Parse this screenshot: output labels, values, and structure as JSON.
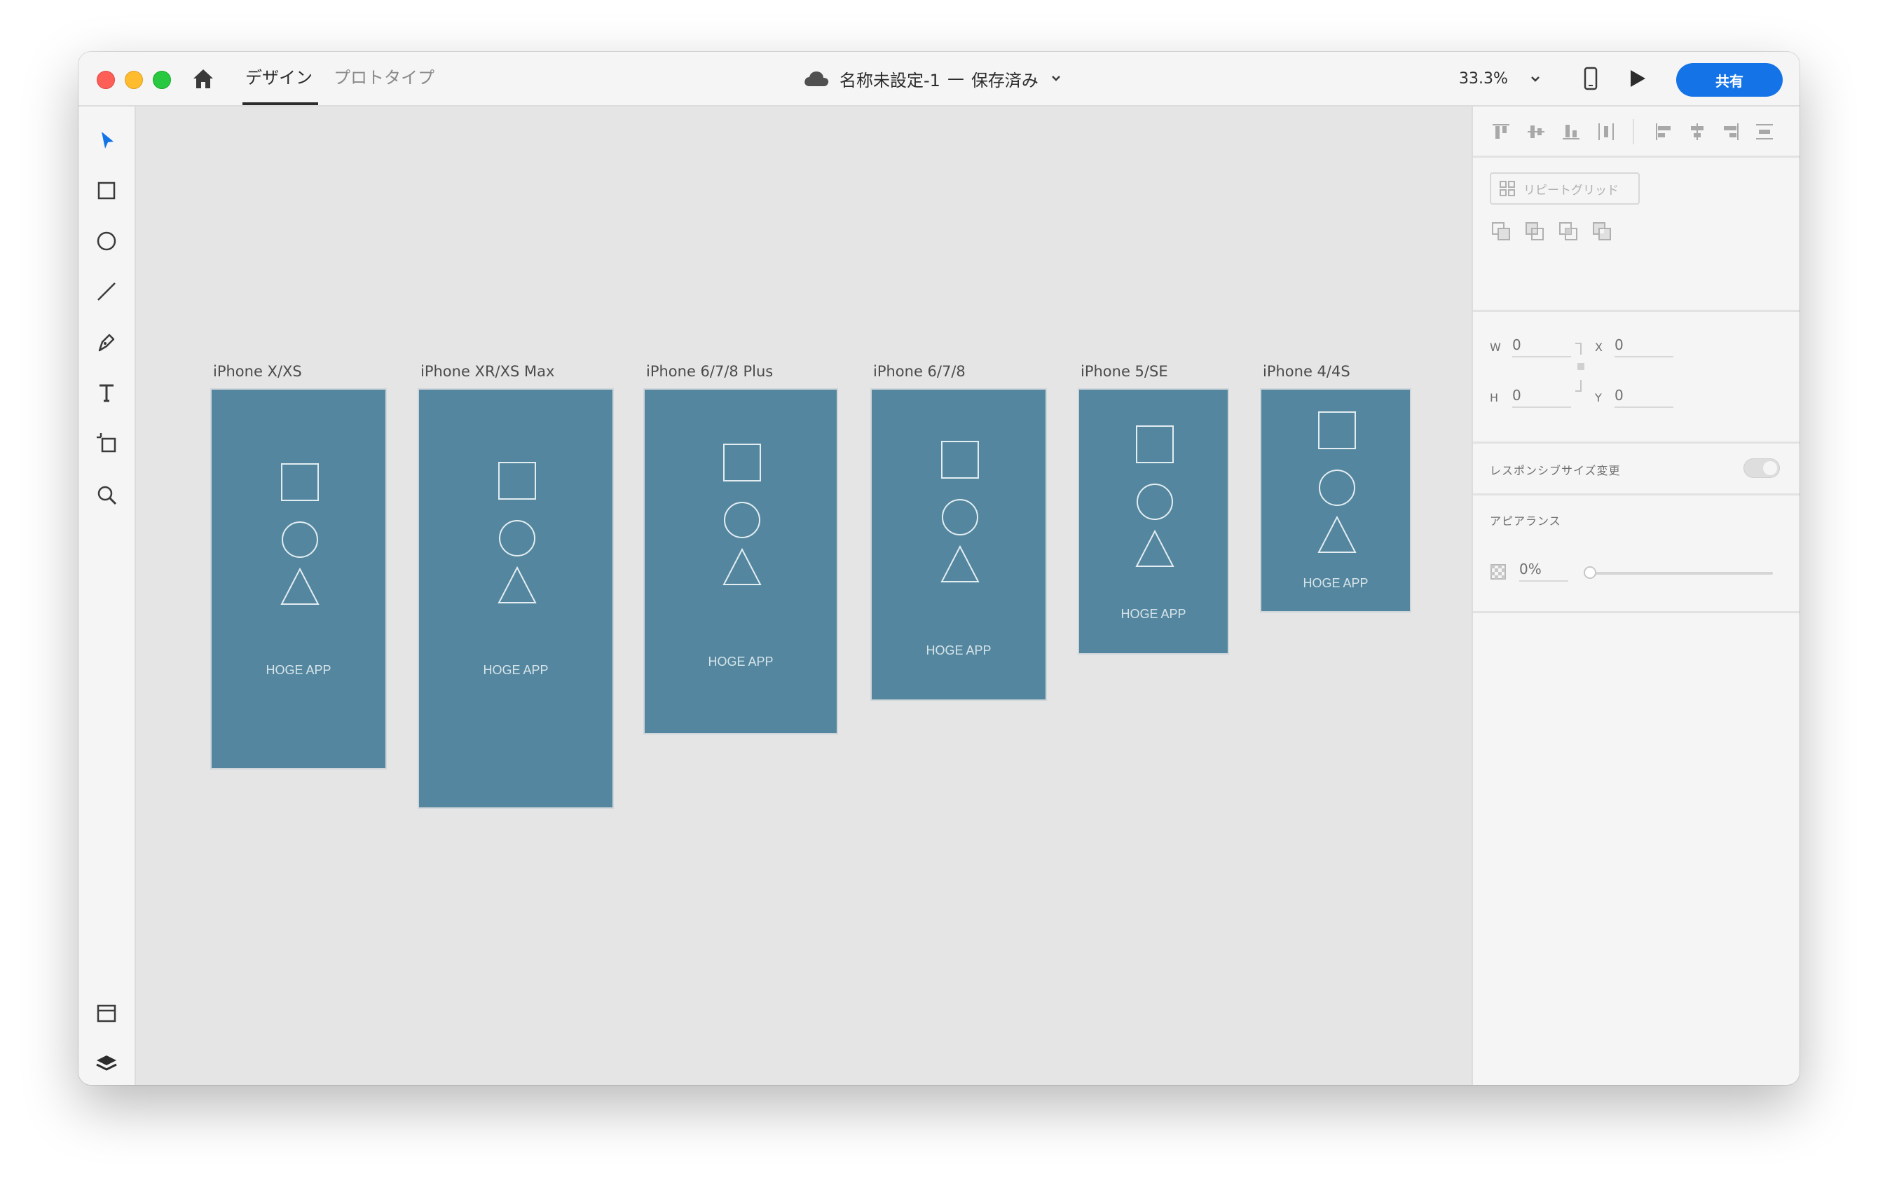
{
  "titlebar": {
    "tabs": [
      {
        "label": "デザイン",
        "active": true
      },
      {
        "label": "プロトタイプ",
        "active": false
      }
    ],
    "doc_name": "名称未設定-1",
    "separator": "—",
    "doc_status": "保存済み",
    "zoom": "33.3%",
    "share_label": "共有"
  },
  "artboards": [
    {
      "name": "iPhone X/XS",
      "app_label": "HOGE APP"
    },
    {
      "name": "iPhone XR/XS Max",
      "app_label": "HOGE APP"
    },
    {
      "name": "iPhone 6/7/8 Plus",
      "app_label": "HOGE APP"
    },
    {
      "name": "iPhone 6/7/8",
      "app_label": "HOGE APP"
    },
    {
      "name": "iPhone 5/SE",
      "app_label": "HOGE APP"
    },
    {
      "name": "iPhone 4/4S",
      "app_label": "HOGE APP"
    }
  ],
  "panel": {
    "repeat_grid_label": "リピートグリッド",
    "w_label": "W",
    "w_value": "0",
    "h_label": "H",
    "h_value": "0",
    "x_label": "X",
    "x_value": "0",
    "y_label": "Y",
    "y_value": "0",
    "responsive_label": "レスポンシブサイズ変更",
    "responsive_on": false,
    "appearance_heading": "アピアランス",
    "opacity_value": "0%",
    "opacity_fraction": 0
  },
  "colors": {
    "artboard_fill": "#54879f",
    "accent": "#1473e6",
    "canvas": "#e5e5e5"
  }
}
